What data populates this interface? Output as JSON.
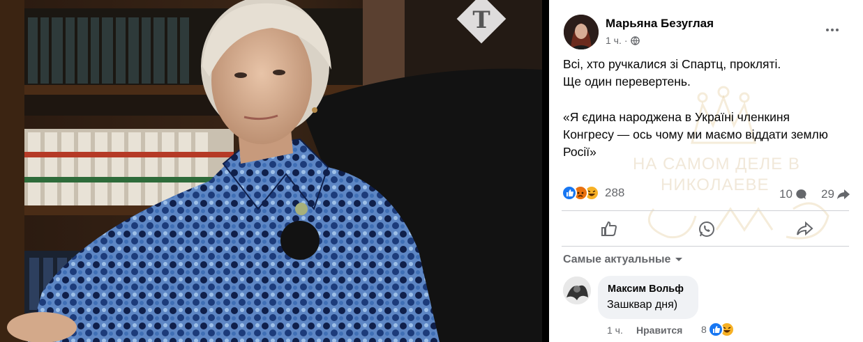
{
  "photo": {
    "logo_letter": "T"
  },
  "post": {
    "author": "Марьяна Безуглая",
    "time": "1 ч.",
    "lines": [
      "Всі, хто ручкалися зі Спартц, прокляті.",
      "Ще один перевертень.",
      "«Я єдина народжена в Україні членкиня",
      "Конгресу — ось чому ми маємо віддати землю",
      "Росії»"
    ],
    "reactions": {
      "icons": [
        "like-icon",
        "angry-icon",
        "haha-icon"
      ],
      "count": "288"
    },
    "comments_count": "10",
    "shares_count": "29",
    "sort_label": "Самые актуальные",
    "watermark": {
      "line1": "НА САМОМ ДЕЛЕ В",
      "line2": "НИКОЛАЕВЕ"
    },
    "comment": {
      "author": "Максим Вольф",
      "text": "Зашквар дня)",
      "time": "1 ч.",
      "like_label": "Нравится",
      "reaction_count": "8",
      "reaction_icons": [
        "like-icon",
        "haha-icon"
      ]
    }
  },
  "colors": {
    "like": "#1877f2",
    "angry": "#e9710f",
    "haha": "#f7b125",
    "meta_gray": "#65676b"
  }
}
